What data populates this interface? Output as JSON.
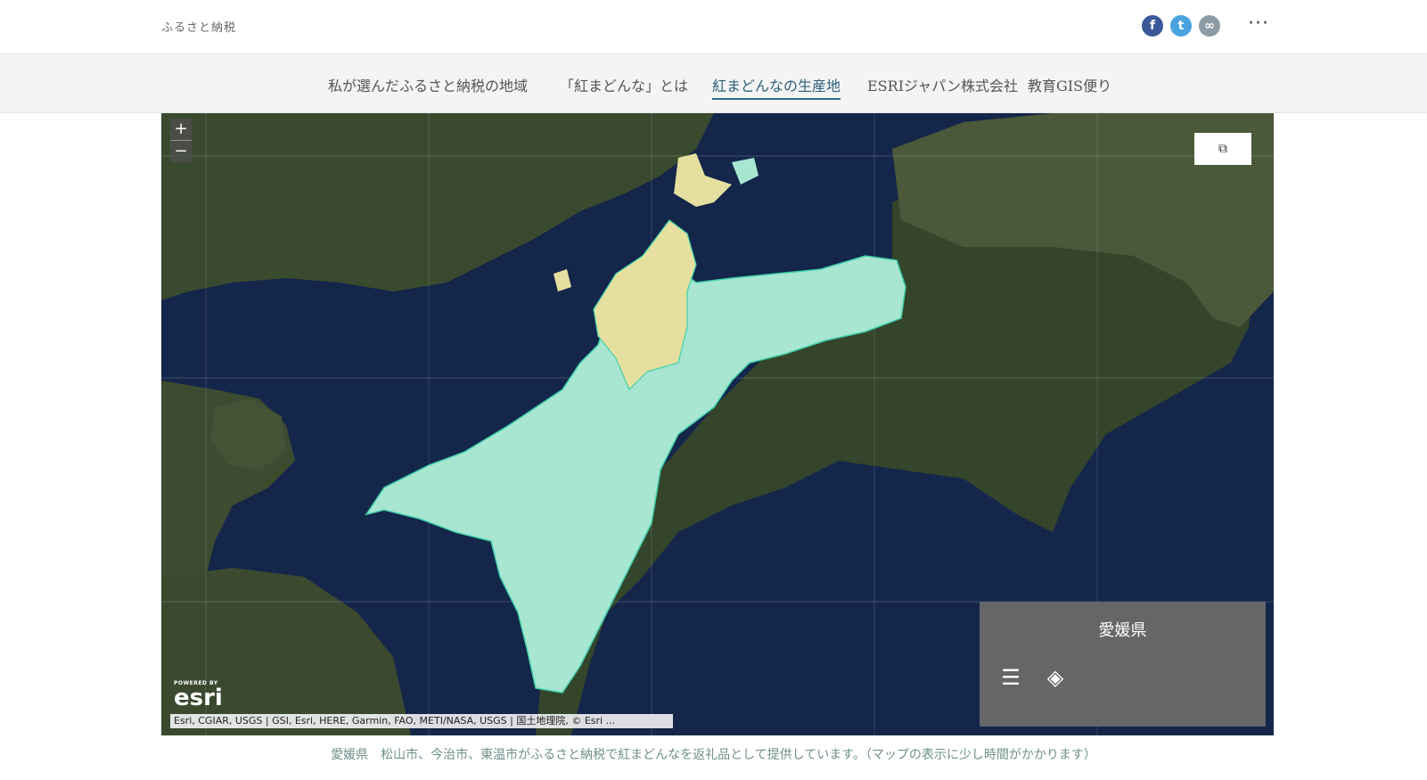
{
  "header": {
    "site_title": "ふるさと納税",
    "more_label": "···"
  },
  "icons": {
    "facebook": "facebook-icon",
    "twitter": "twitter-icon",
    "link": "link-icon",
    "more": "more-icon",
    "zoom_in": "plus-icon",
    "zoom_out": "minus-icon",
    "expand": "external-link-icon",
    "legend_list": "list-icon",
    "layers": "layers-icon"
  },
  "nav": {
    "items": [
      {
        "label": "私が選んだふるさと納税の地域",
        "active": false
      },
      {
        "label": "「紅まどんな」とは",
        "active": false
      },
      {
        "label": "紅まどんなの生産地",
        "active": true
      },
      {
        "label": "ESRIジャパン株式会社",
        "active": false
      },
      {
        "label": "教育GIS便り",
        "active": false
      }
    ]
  },
  "map": {
    "zoom_in_label": "+",
    "zoom_out_label": "−",
    "legend_title": "愛媛県",
    "attribution": "Esri, CGIAR, USGS | GSI, Esri, HERE, Garmin, FAO, METI/NASA, USGS | 国土地理院, © Esri ...",
    "esri_powered": "POWERED BY",
    "esri_wordmark": "esri",
    "colors": {
      "water": "#14264a",
      "land": "#3b4a2e",
      "prefecture": "#a8e6d2",
      "highlight": "#e6e0a0",
      "boundary": "#3fd0aa"
    }
  },
  "caption": "愛媛県　松山市、今治市、東温市がふるさと納税で紅まどんなを返礼品として提供しています。（マップの表示に少し時間がかかります）"
}
